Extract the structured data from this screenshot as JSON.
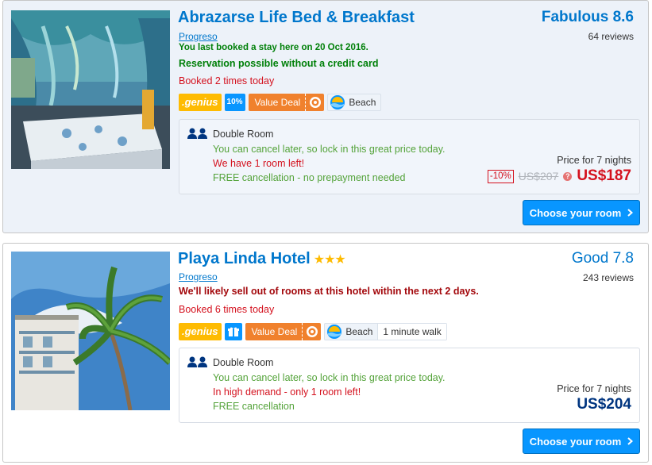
{
  "colors": {
    "link_blue": "#0077cc",
    "green": "#008009",
    "red": "#d4111e",
    "cta_blue": "#0896ff",
    "genius_yellow": "#febb02",
    "deal_orange": "#f0812d"
  },
  "results": [
    {
      "name": "Abrazarse Life Bed & Breakfast",
      "stars": "",
      "location": "Progreso",
      "last_booked": "You last booked a stay here on 20 Oct 2016.",
      "no_credit_card": "Reservation possible without a credit card",
      "booked_times": "Booked 2 times today",
      "genius_label": ".genius",
      "genius_discount": "10%",
      "deal_label": "Value Deal",
      "beach_label": "Beach",
      "score_word": "Fabulous 8.6",
      "reviews": "64 reviews",
      "room": {
        "icon": "two-guests-icon",
        "name": "Double Room",
        "line1": "You can cancel later, so lock in this great price today.",
        "line2": "We have 1 room left!",
        "line3": "FREE cancellation - no prepayment needed"
      },
      "price_for": "Price for 7 nights",
      "discount": "-10%",
      "old_price": "US$207",
      "price": "US$187",
      "button": "Choose your room"
    },
    {
      "name": "Playa Linda Hotel",
      "stars": "★★★",
      "location": "Progreso",
      "sell_out": "We'll likely sell out of rooms at this hotel within the next 2 days.",
      "booked_times": "Booked 6 times today",
      "genius_label": ".genius",
      "deal_label": "Value Deal",
      "beach_label": "Beach",
      "walk_label": "1 minute walk",
      "score_word": "Good 7.8",
      "reviews": "243 reviews",
      "room": {
        "icon": "two-guests-icon",
        "name": "Double Room",
        "line1": "You can cancel later, so lock in this great price today.",
        "line2": "In high demand - only 1 room left!",
        "line3": "FREE cancellation"
      },
      "price_for": "Price for 7 nights",
      "price": "US$204",
      "button": "Choose your room"
    }
  ]
}
